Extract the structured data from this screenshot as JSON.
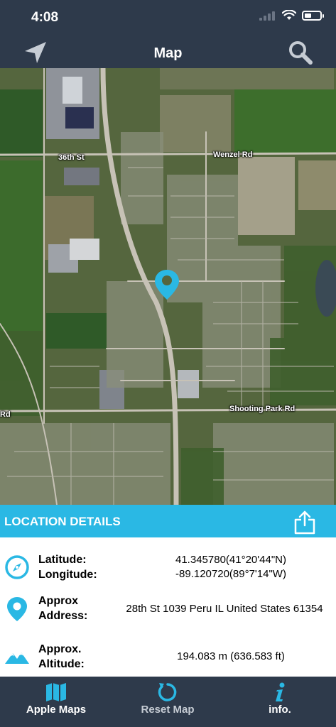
{
  "status_bar": {
    "time": "4:08"
  },
  "nav": {
    "title": "Map",
    "left_icon": "location-arrow-icon",
    "right_icon": "search-icon"
  },
  "map": {
    "roads": {
      "road_36th": "36th St",
      "wenzel": "Wenzel Rd",
      "shooting_park": "Shooting Park Rd",
      "rd_left": "Rd"
    },
    "pin_color": "#2ab8e4"
  },
  "details": {
    "header": "LOCATION DETAILS",
    "share_icon": "share-icon",
    "latitude_label": "Latitude:",
    "longitude_label": "Longitude:",
    "latitude_value": "41.345780(41°20'44\"N)",
    "longitude_value": "-89.120720(89°7'14\"W)",
    "address_label_1": "Approx",
    "address_label_2": "Address:",
    "address_value": "28th St 1039 Peru  IL United States 61354",
    "altitude_label_1": "Approx.",
    "altitude_label_2": "Altitude:",
    "altitude_value": "194.083 m (636.583 ft)"
  },
  "tabbar": {
    "items": [
      {
        "label": "Apple Maps",
        "icon": "map-icon",
        "color": "#ffffff"
      },
      {
        "label": "Reset Map",
        "icon": "reset-icon",
        "color": "#c6ccd4"
      },
      {
        "label": "info.",
        "icon": "info-icon",
        "color": "#ffffff"
      }
    ]
  },
  "colors": {
    "accent": "#2ab8e4",
    "bar": "#2e3a4b"
  }
}
